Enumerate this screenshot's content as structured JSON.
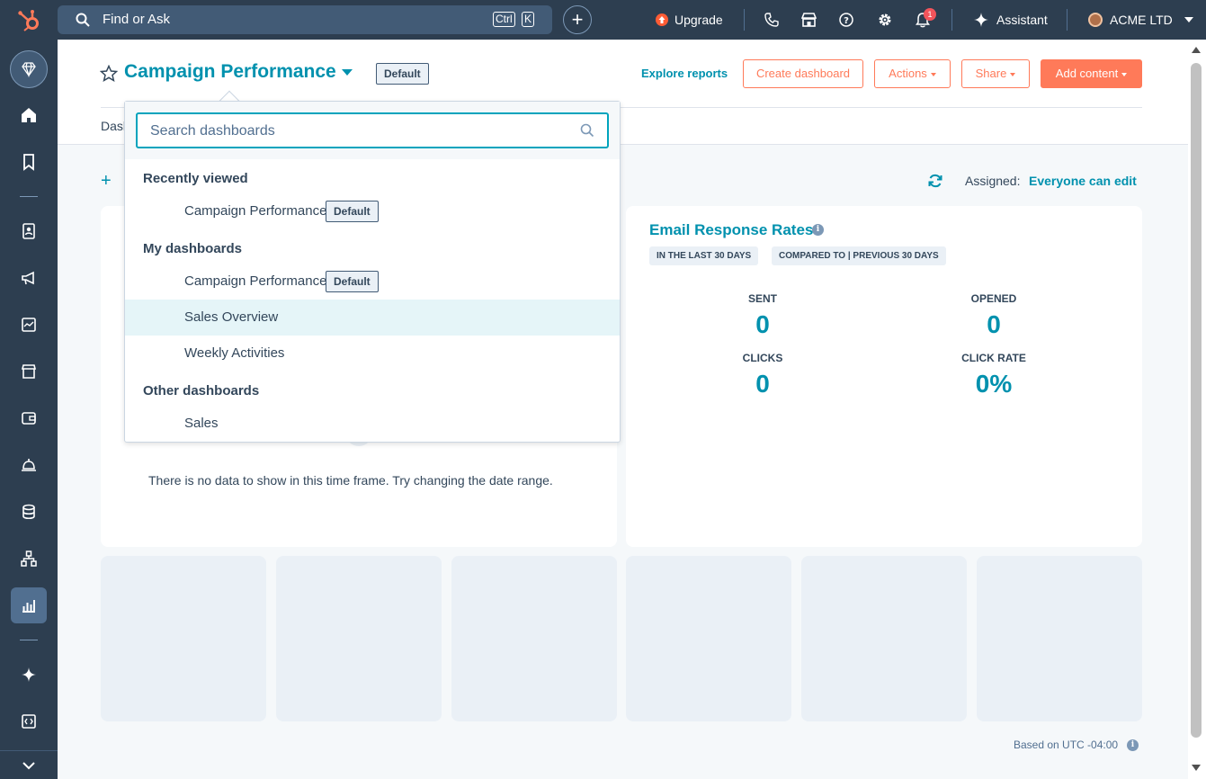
{
  "topbar": {
    "search_label": "Find or Ask",
    "shortcut_ctrl": "Ctrl",
    "shortcut_key": "K",
    "upgrade_label": "Upgrade",
    "notification_count": "1",
    "assistant_label": "Assistant",
    "account_name": "ACME LTD"
  },
  "header": {
    "title": "Campaign Performance",
    "default_tag": "Default",
    "explore_reports": "Explore reports",
    "create_dashboard": "Create dashboard",
    "actions": "Actions",
    "share": "Share",
    "add_content": "Add content",
    "tab_partial": "Dasl",
    "assigned_label": "Assigned:",
    "assigned_value": "Everyone can edit"
  },
  "dropdown": {
    "search_placeholder": "Search dashboards",
    "recently_viewed_heading": "Recently viewed",
    "recently_viewed": [
      {
        "name": "Campaign Performance",
        "tag": "Default"
      }
    ],
    "my_dashboards_heading": "My dashboards",
    "my_dashboards": [
      {
        "name": "Campaign Performance",
        "tag": "Default"
      },
      {
        "name": "Sales Overview"
      },
      {
        "name": "Weekly Activities"
      }
    ],
    "other_dashboards_heading": "Other dashboards",
    "other_dashboards": [
      {
        "name": "Sales"
      }
    ]
  },
  "left_card": {
    "no_data_message": "There is no data to show in this time frame. Try changing the date range."
  },
  "email_card": {
    "title": "Email Response Rates",
    "pill_range": "IN THE LAST 30 DAYS",
    "pill_compare": "COMPARED TO | PREVIOUS 30 DAYS",
    "metrics": [
      {
        "label": "SENT",
        "value": "0"
      },
      {
        "label": "OPENED",
        "value": "0"
      },
      {
        "label": "CLICKS",
        "value": "0"
      },
      {
        "label": "CLICK RATE",
        "value": "0%"
      }
    ]
  },
  "footer": {
    "timezone": "Based on UTC -04:00"
  },
  "colors": {
    "nav_bg": "#2d3e50",
    "accent": "#0091ae",
    "cta": "#ff7a59"
  }
}
